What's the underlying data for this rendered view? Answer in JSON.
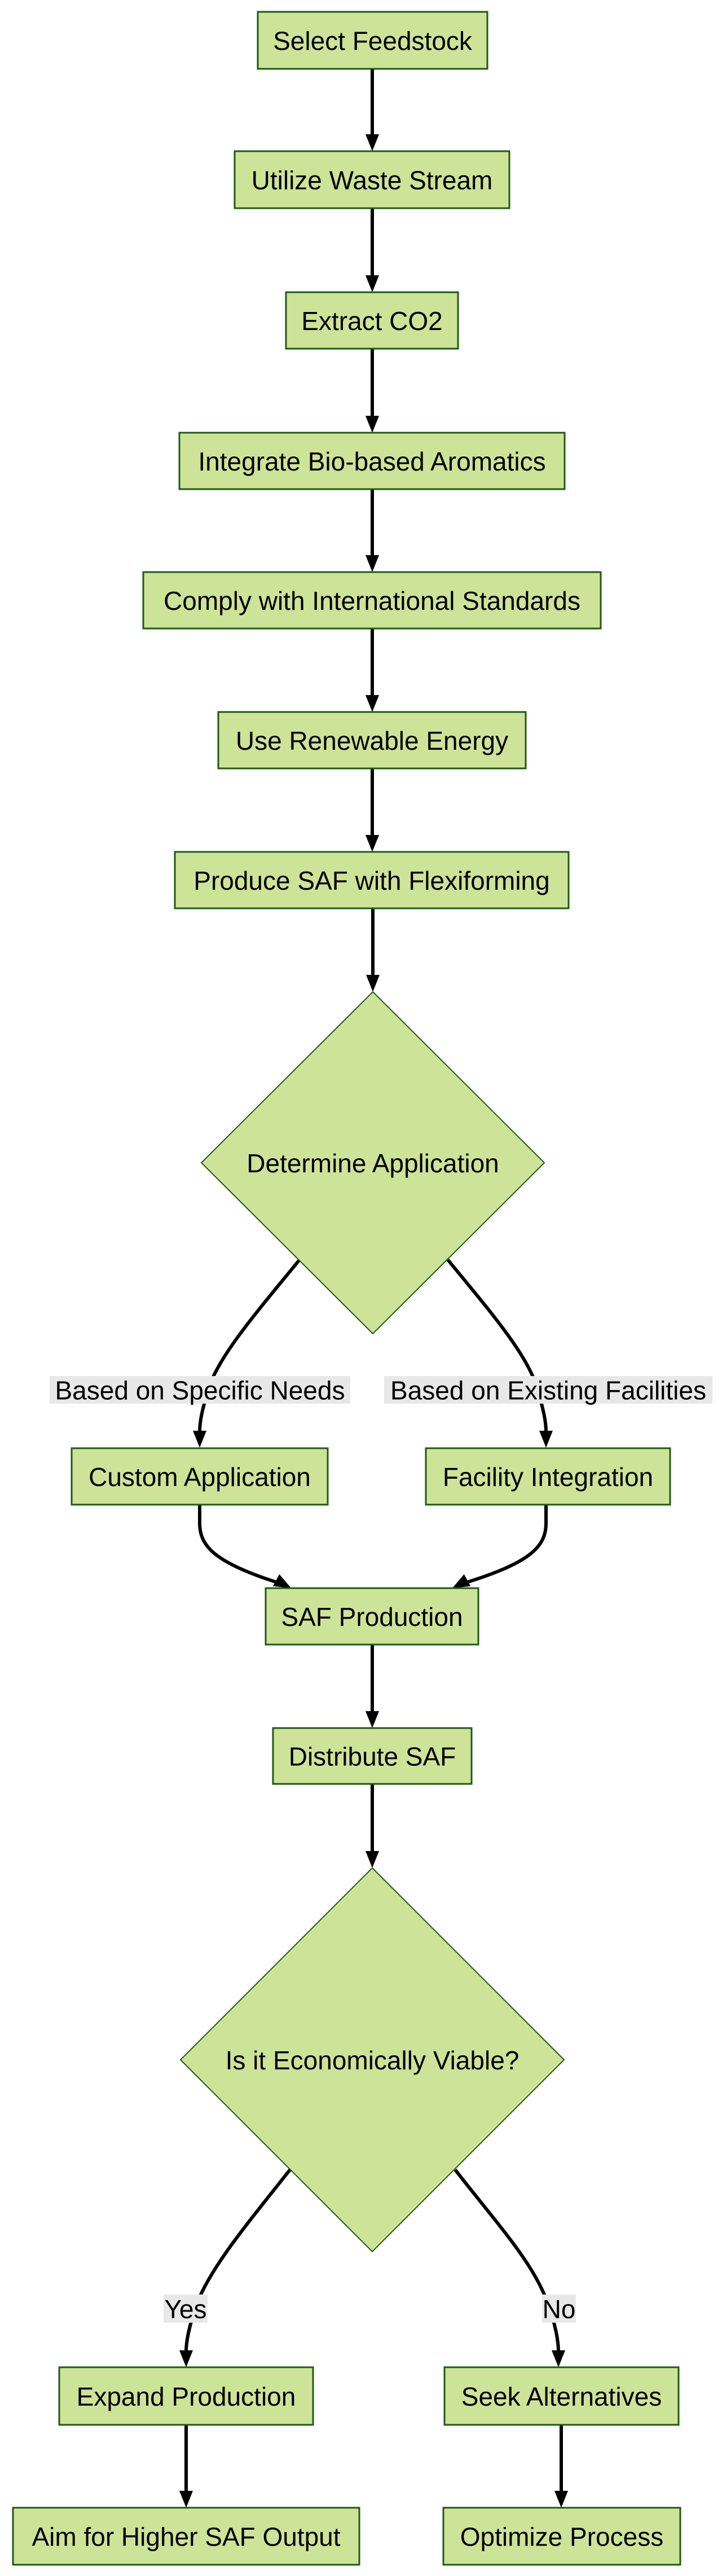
{
  "diagram": {
    "type": "flowchart",
    "direction": "top-down",
    "colors": {
      "node_fill": "#cde498",
      "node_stroke": "#1f5a14",
      "edge": "#000000",
      "edge_label_bg": "#e8e8e8",
      "text": "#000000"
    },
    "nodes": [
      {
        "id": "select_feedstock",
        "shape": "rect",
        "label": "Select Feedstock"
      },
      {
        "id": "utilize_waste_stream",
        "shape": "rect",
        "label": "Utilize Waste Stream"
      },
      {
        "id": "extract_co2",
        "shape": "rect",
        "label": "Extract CO2"
      },
      {
        "id": "integrate_aromatics",
        "shape": "rect",
        "label": "Integrate Bio-based Aromatics"
      },
      {
        "id": "comply_standards",
        "shape": "rect",
        "label": "Comply with International Standards"
      },
      {
        "id": "use_renewable_energy",
        "shape": "rect",
        "label": "Use Renewable Energy"
      },
      {
        "id": "produce_saf_flexiforming",
        "shape": "rect",
        "label": "Produce SAF with Flexiforming"
      },
      {
        "id": "determine_application",
        "shape": "diamond",
        "label": "Determine Application"
      },
      {
        "id": "custom_application",
        "shape": "rect",
        "label": "Custom Application"
      },
      {
        "id": "facility_integration",
        "shape": "rect",
        "label": "Facility Integration"
      },
      {
        "id": "saf_production",
        "shape": "rect",
        "label": "SAF Production"
      },
      {
        "id": "distribute_saf",
        "shape": "rect",
        "label": "Distribute SAF"
      },
      {
        "id": "economically_viable",
        "shape": "diamond",
        "label": "Is it Economically Viable?"
      },
      {
        "id": "expand_production",
        "shape": "rect",
        "label": "Expand Production"
      },
      {
        "id": "seek_alternatives",
        "shape": "rect",
        "label": "Seek Alternatives"
      },
      {
        "id": "aim_higher_output",
        "shape": "rect",
        "label": "Aim for Higher SAF Output"
      },
      {
        "id": "optimize_process",
        "shape": "rect",
        "label": "Optimize Process"
      }
    ],
    "edges": [
      {
        "from": "select_feedstock",
        "to": "utilize_waste_stream",
        "label": ""
      },
      {
        "from": "utilize_waste_stream",
        "to": "extract_co2",
        "label": ""
      },
      {
        "from": "extract_co2",
        "to": "integrate_aromatics",
        "label": ""
      },
      {
        "from": "integrate_aromatics",
        "to": "comply_standards",
        "label": ""
      },
      {
        "from": "comply_standards",
        "to": "use_renewable_energy",
        "label": ""
      },
      {
        "from": "use_renewable_energy",
        "to": "produce_saf_flexiforming",
        "label": ""
      },
      {
        "from": "produce_saf_flexiforming",
        "to": "determine_application",
        "label": ""
      },
      {
        "from": "determine_application",
        "to": "custom_application",
        "label": "Based on Specific Needs"
      },
      {
        "from": "determine_application",
        "to": "facility_integration",
        "label": "Based on Existing Facilities"
      },
      {
        "from": "custom_application",
        "to": "saf_production",
        "label": ""
      },
      {
        "from": "facility_integration",
        "to": "saf_production",
        "label": ""
      },
      {
        "from": "saf_production",
        "to": "distribute_saf",
        "label": ""
      },
      {
        "from": "distribute_saf",
        "to": "economically_viable",
        "label": ""
      },
      {
        "from": "economically_viable",
        "to": "expand_production",
        "label": "Yes"
      },
      {
        "from": "economically_viable",
        "to": "seek_alternatives",
        "label": "No"
      },
      {
        "from": "expand_production",
        "to": "aim_higher_output",
        "label": ""
      },
      {
        "from": "seek_alternatives",
        "to": "optimize_process",
        "label": ""
      }
    ]
  }
}
